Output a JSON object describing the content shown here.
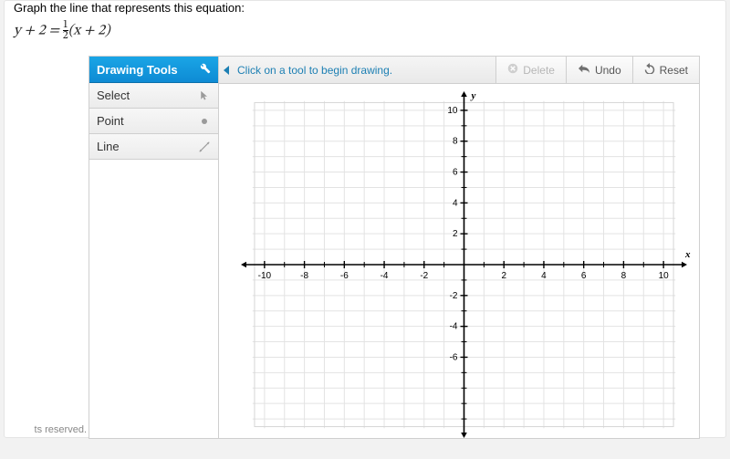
{
  "question": {
    "prompt": "Graph the line that represents this equation:",
    "equation_left": "y + 2 =",
    "equation_frac_num": "1",
    "equation_frac_den": "2",
    "equation_right": "(x + 2)"
  },
  "tool_panel": {
    "header": "Drawing Tools",
    "tools": [
      {
        "label": "Select",
        "icon": "cursor"
      },
      {
        "label": "Point",
        "icon": "dot"
      },
      {
        "label": "Line",
        "icon": "line-arrows"
      }
    ]
  },
  "canvas_toolbar": {
    "hint": "Click on a tool to begin drawing.",
    "delete_label": "Delete",
    "undo_label": "Undo",
    "reset_label": "Reset"
  },
  "footer_text": "ts reserved.",
  "chart_data": {
    "type": "scatter",
    "title": "",
    "xlabel": "x",
    "ylabel": "y",
    "xlim": [
      -11,
      11
    ],
    "ylim": [
      -11,
      11
    ],
    "x_ticks": [
      -10,
      -8,
      -6,
      -4,
      -2,
      2,
      4,
      6,
      8,
      10
    ],
    "y_ticks": [
      -6,
      -4,
      -2,
      2,
      4,
      6,
      8,
      10
    ],
    "x_minor_step": 1,
    "y_minor_step": 1,
    "grid": true,
    "series": []
  }
}
